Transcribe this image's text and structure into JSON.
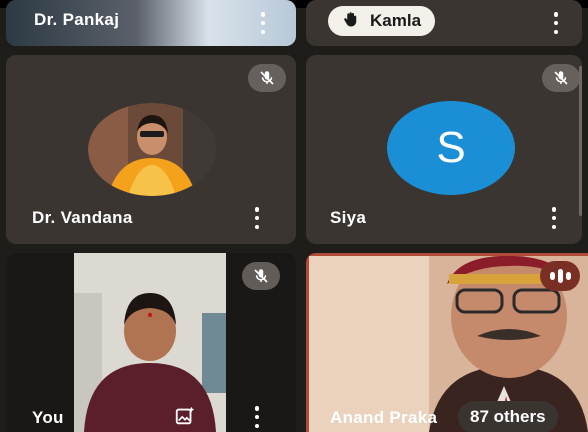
{
  "participants": {
    "pankaj": {
      "name": "Dr. Pankaj"
    },
    "kamla": {
      "name": "Kamla",
      "hand_raised": true
    },
    "vandana": {
      "name": "Dr. Vandana",
      "muted": true
    },
    "siya": {
      "name": "Siya",
      "initial": "S",
      "avatar_color": "#1a8fd6",
      "muted": true
    },
    "you": {
      "name": "You",
      "muted": true
    },
    "anand": {
      "name": "Anand Praka",
      "speaking": true
    }
  },
  "others_badge": "87 others",
  "colors": {
    "background": "#1f1d1a",
    "tile": "#3b3532",
    "speaking_badge": "#7a2f25"
  }
}
